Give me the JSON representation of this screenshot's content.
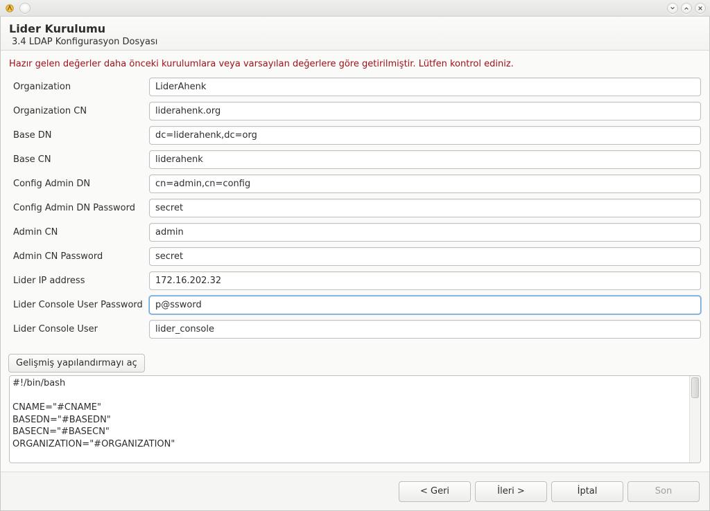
{
  "titlebar": {
    "app_name": ""
  },
  "header": {
    "title": "Lider Kurulumu",
    "subtitle": "3.4 LDAP Konfigurasyon Dosyası"
  },
  "notice": "Hazır gelen değerler daha önceki kurulumlara veya varsayılan değerlere göre getirilmiştir. Lütfen kontrol ediniz.",
  "form": {
    "organization": {
      "label": "Organization",
      "value": "LiderAhenk"
    },
    "organization_cn": {
      "label": "Organization CN",
      "value": "liderahenk.org"
    },
    "base_dn": {
      "label": "Base DN",
      "value": "dc=liderahenk,dc=org"
    },
    "base_cn": {
      "label": "Base CN",
      "value": "liderahenk"
    },
    "config_admin_dn": {
      "label": "Config Admin DN",
      "value": "cn=admin,cn=config"
    },
    "config_admin_dn_pw": {
      "label": "Config Admin DN Password",
      "value": "secret"
    },
    "admin_cn": {
      "label": "Admin CN",
      "value": "admin"
    },
    "admin_cn_pw": {
      "label": "Admin CN Password",
      "value": "secret"
    },
    "lider_ip": {
      "label": "Lider IP address",
      "value": "172.16.202.32"
    },
    "lider_console_pw": {
      "label": "Lider Console User Password",
      "value": "p@ssword"
    },
    "lider_console_user": {
      "label": "Lider Console User",
      "value": "lider_console"
    }
  },
  "advanced_button": "Gelişmiş yapılandırmayı aç",
  "script": "#!/bin/bash\n\nCNAME=\"#CNAME\"\nBASEDN=\"#BASEDN\"\nBASECN=\"#BASECN\"\nORGANIZATION=\"#ORGANIZATION\"",
  "footer": {
    "back": "< Geri",
    "next": "İleri >",
    "cancel": "İptal",
    "finish": "Son"
  }
}
